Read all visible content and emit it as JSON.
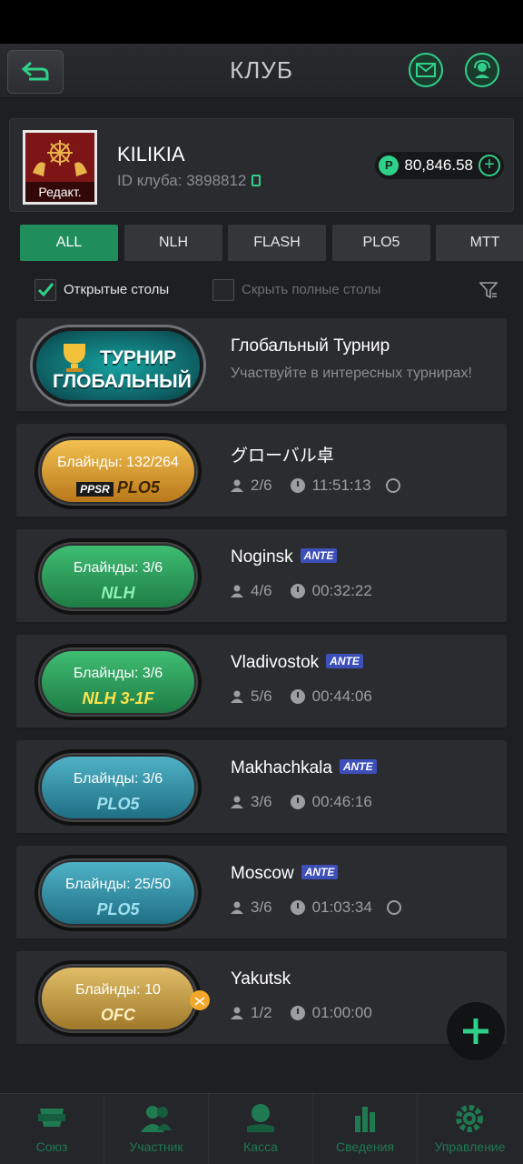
{
  "header": {
    "title": "КЛУБ"
  },
  "club": {
    "name": "KILIKIA",
    "id_text": "ID клуба: 3898812",
    "logo_edit": "Редакт.",
    "balance": "80,846.58",
    "coin_symbol": "P"
  },
  "tabs": [
    {
      "label": "ALL",
      "active": true
    },
    {
      "label": "NLH",
      "active": false
    },
    {
      "label": "FLASH",
      "active": false
    },
    {
      "label": "PLO5",
      "active": false
    },
    {
      "label": "MTT",
      "active": false
    }
  ],
  "filters": {
    "open_tables": "Открытые столы",
    "open_tables_checked": true,
    "hide_full": "Скрыть полные столы",
    "hide_full_checked": false
  },
  "tournament": {
    "logo_line1": "ТУРНИР",
    "logo_line2": "ГЛОБАЛЬНЫЙ",
    "title": "Глобальный Турнир",
    "subtitle": "Участвуйте в интересных турнирах!"
  },
  "tables": [
    {
      "blinds": "Блайнды: 132/264",
      "game": "PLO5",
      "game_prefix": "PPSR",
      "name": "グローバル卓",
      "ante": "",
      "players": "2/6",
      "time": "11:51:13",
      "timer": true,
      "color": "gold"
    },
    {
      "blinds": "Блайнды: 3/6",
      "game": "NLH",
      "game_prefix": "",
      "name": "Noginsk",
      "ante": "ANTE",
      "players": "4/6",
      "time": "00:32:22",
      "timer": false,
      "color": "green"
    },
    {
      "blinds": "Блайнды: 3/6",
      "game": "NLH 3-1F",
      "game_prefix": "",
      "name": "Vladivostok",
      "ante": "ANTE",
      "players": "5/6",
      "time": "00:44:06",
      "timer": false,
      "color": "green"
    },
    {
      "blinds": "Блайнды: 3/6",
      "game": "PLO5",
      "game_prefix": "",
      "name": "Makhachkala",
      "ante": "ANTE",
      "players": "3/6",
      "time": "00:46:16",
      "timer": false,
      "color": "blue"
    },
    {
      "blinds": "Блайнды: 25/50",
      "game": "PLO5",
      "game_prefix": "",
      "name": "Moscow",
      "ante": "ANTE",
      "players": "3/6",
      "time": "01:03:34",
      "timer": true,
      "color": "blue"
    },
    {
      "blinds": "Блайнды: 10",
      "game": "OFC",
      "game_prefix": "",
      "name": "Yakutsk",
      "ante": "",
      "players": "1/2",
      "time": "01:00:00",
      "timer": false,
      "color": "tan"
    }
  ],
  "bottom_nav": [
    {
      "label": "Союз",
      "icon": "union-icon"
    },
    {
      "label": "Участник",
      "icon": "members-icon"
    },
    {
      "label": "Касса",
      "icon": "cashier-icon"
    },
    {
      "label": "Сведения",
      "icon": "stats-icon"
    },
    {
      "label": "Управление",
      "icon": "settings-icon"
    }
  ],
  "colors": {
    "accent": "#2fd18a",
    "tab_active": "#1f8e5c",
    "pill_gold": "#d9a12b",
    "pill_green": "#2aa25e",
    "pill_blue": "#2f93a8",
    "pill_tan": "#c9a14a"
  }
}
